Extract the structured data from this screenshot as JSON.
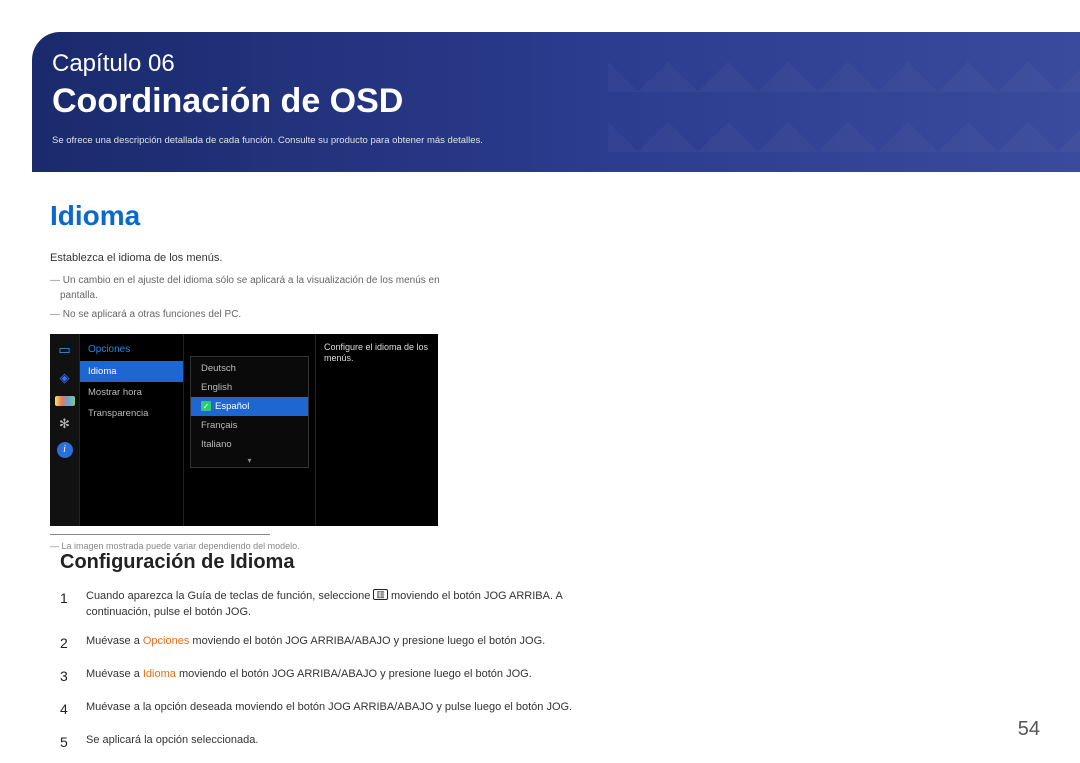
{
  "header": {
    "chapter_line": "Capítulo 06",
    "title": "Coordinación de OSD",
    "description": "Se ofrece una descripción detallada de cada función. Consulte su producto para obtener más detalles."
  },
  "left": {
    "heading": "Idioma",
    "intro": "Establezca el idioma de los menús.",
    "notes": [
      "Un cambio en el ajuste del idioma sólo se aplicará a la visualización de los menús en pantalla.",
      "No se aplicará a otras funciones del PC."
    ],
    "footnote": "La imagen mostrada puede variar dependiendo del modelo."
  },
  "osd": {
    "menu_title": "Opciones",
    "menu_items": [
      "Idioma",
      "Mostrar hora",
      "Transparencia"
    ],
    "active_menu_index": 0,
    "languages": [
      "Deutsch",
      "English",
      "Español",
      "Français",
      "Italiano"
    ],
    "selected_language_index": 2,
    "help_text": "Configure el idioma de los menús.",
    "info_glyph": "i"
  },
  "right": {
    "heading": "Configuración de Idioma",
    "menu_icon_glyph": "▥",
    "steps": [
      {
        "pre": "Cuando aparezca la Guía de teclas de función, seleccione ",
        "post": " moviendo el botón JOG ARRIBA. A continuación, pulse el botón JOG.",
        "has_icon": true
      },
      {
        "pre": "Muévase a ",
        "hl": "Opciones",
        "post": " moviendo el botón JOG ARRIBA/ABAJO y presione luego el botón JOG."
      },
      {
        "pre": "Muévase a ",
        "hl": "Idioma",
        "post": " moviendo el botón JOG ARRIBA/ABAJO y presione luego el botón JOG."
      },
      {
        "full": "Muévase a la opción deseada moviendo el botón JOG ARRIBA/ABAJO y pulse luego el botón JOG."
      },
      {
        "full": "Se aplicará la opción seleccionada."
      }
    ]
  },
  "page_number": "54"
}
